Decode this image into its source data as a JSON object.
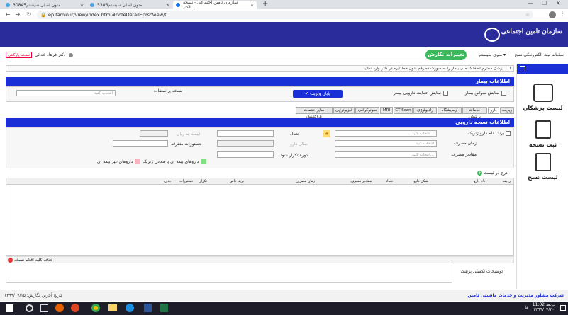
{
  "browser": {
    "tabs": [
      {
        "label": "متون اصلی سیستم30845",
        "active": false
      },
      {
        "label": "متون اصلی سیستم5306",
        "active": false
      },
      {
        "label": "سازمان تامین اجتماعی - نسخه الکتر...",
        "active": true
      }
    ],
    "url": "ep.tamin.ir/view/index.html#noteDetailEprscView/0"
  },
  "header": {
    "logo_text": "سازمان تامین اجتماعی"
  },
  "nav": {
    "system_title": "سامانه ثبت الکترونیکی نسخ",
    "menu": "منوی سیستم",
    "change_button": "تغییرات نگارش",
    "user": "دکتر فرهاد خدائی",
    "draft": "نسخه پارکنتی"
  },
  "sidebar": {
    "items": [
      "لیست پزشکان",
      "ثبت نسخه",
      "لیست نسخ"
    ]
  },
  "notice": "پزشک محترم لطفا کد ملی بیمار را به صورت ده رقم بدون خط تیره در کادر وارد نمائید",
  "patient": {
    "section_title": "اطلاعات بیمار",
    "history_label": "نمایش سوابق بیمار",
    "insurance_label": "نمایش حمایت دارویی بیمار",
    "end_visit": "پایان ویزیت",
    "prescription_use": "نسخه پراستفاده",
    "select_placeholder": "انتخاب کنید"
  },
  "tabs": [
    "ویزیت",
    "دارو",
    "خدمات پزشکی",
    "آزمایشگاه",
    "رادیولوژی",
    "CT Scan",
    "MRI",
    "سونوگرافی",
    "فیزیوتراپی",
    "سایر خدمات پاراکلینیک"
  ],
  "drug": {
    "section_title": "اطلاعات نسخه دارویی",
    "brand": "برند",
    "generic_name": "نام دارو ژنریک",
    "usage_time": "زمان مصرف",
    "amount": "مقادیر مصرف",
    "count": "تعداد",
    "drug_form": "شکل دارو",
    "repeat": "دوره تکرار شود",
    "instructions": "دستورات متفرقه",
    "select_placeholder": "انتخاب کنید...",
    "select_placeholder2": "انتخاب کنید",
    "insurance_drug": "داروهای بیمه ای یا معادل ژنریک",
    "non_insurance_drug": "داروهای غیر بیمه ای",
    "price_label": "قیمت به ریال",
    "add_to_list": "درج در لیست"
  },
  "table": {
    "headers": [
      "ردیف",
      "نام دارو",
      "شکل دارو",
      "تعداد",
      "مقادیر مصرف",
      "زمان مصرف",
      "برند خاص",
      "تکرار",
      "دستورات",
      "حذف"
    ]
  },
  "delete_all": "حذف کلیه اقلام نسخه",
  "notes_label": "توضیحات تکمیلی پزشک",
  "footer": {
    "company": "شرکت مشاور مدیریت و خدمات ماشینی تامین",
    "last_update": "تاریخ آخرین نگارش: ۱۳۹۹/۰۷/۱۵"
  },
  "taskbar": {
    "time": "11:02 ب.ظ",
    "date": "۱۳۹۹/۰۷/۲۰",
    "lang": "فا"
  }
}
